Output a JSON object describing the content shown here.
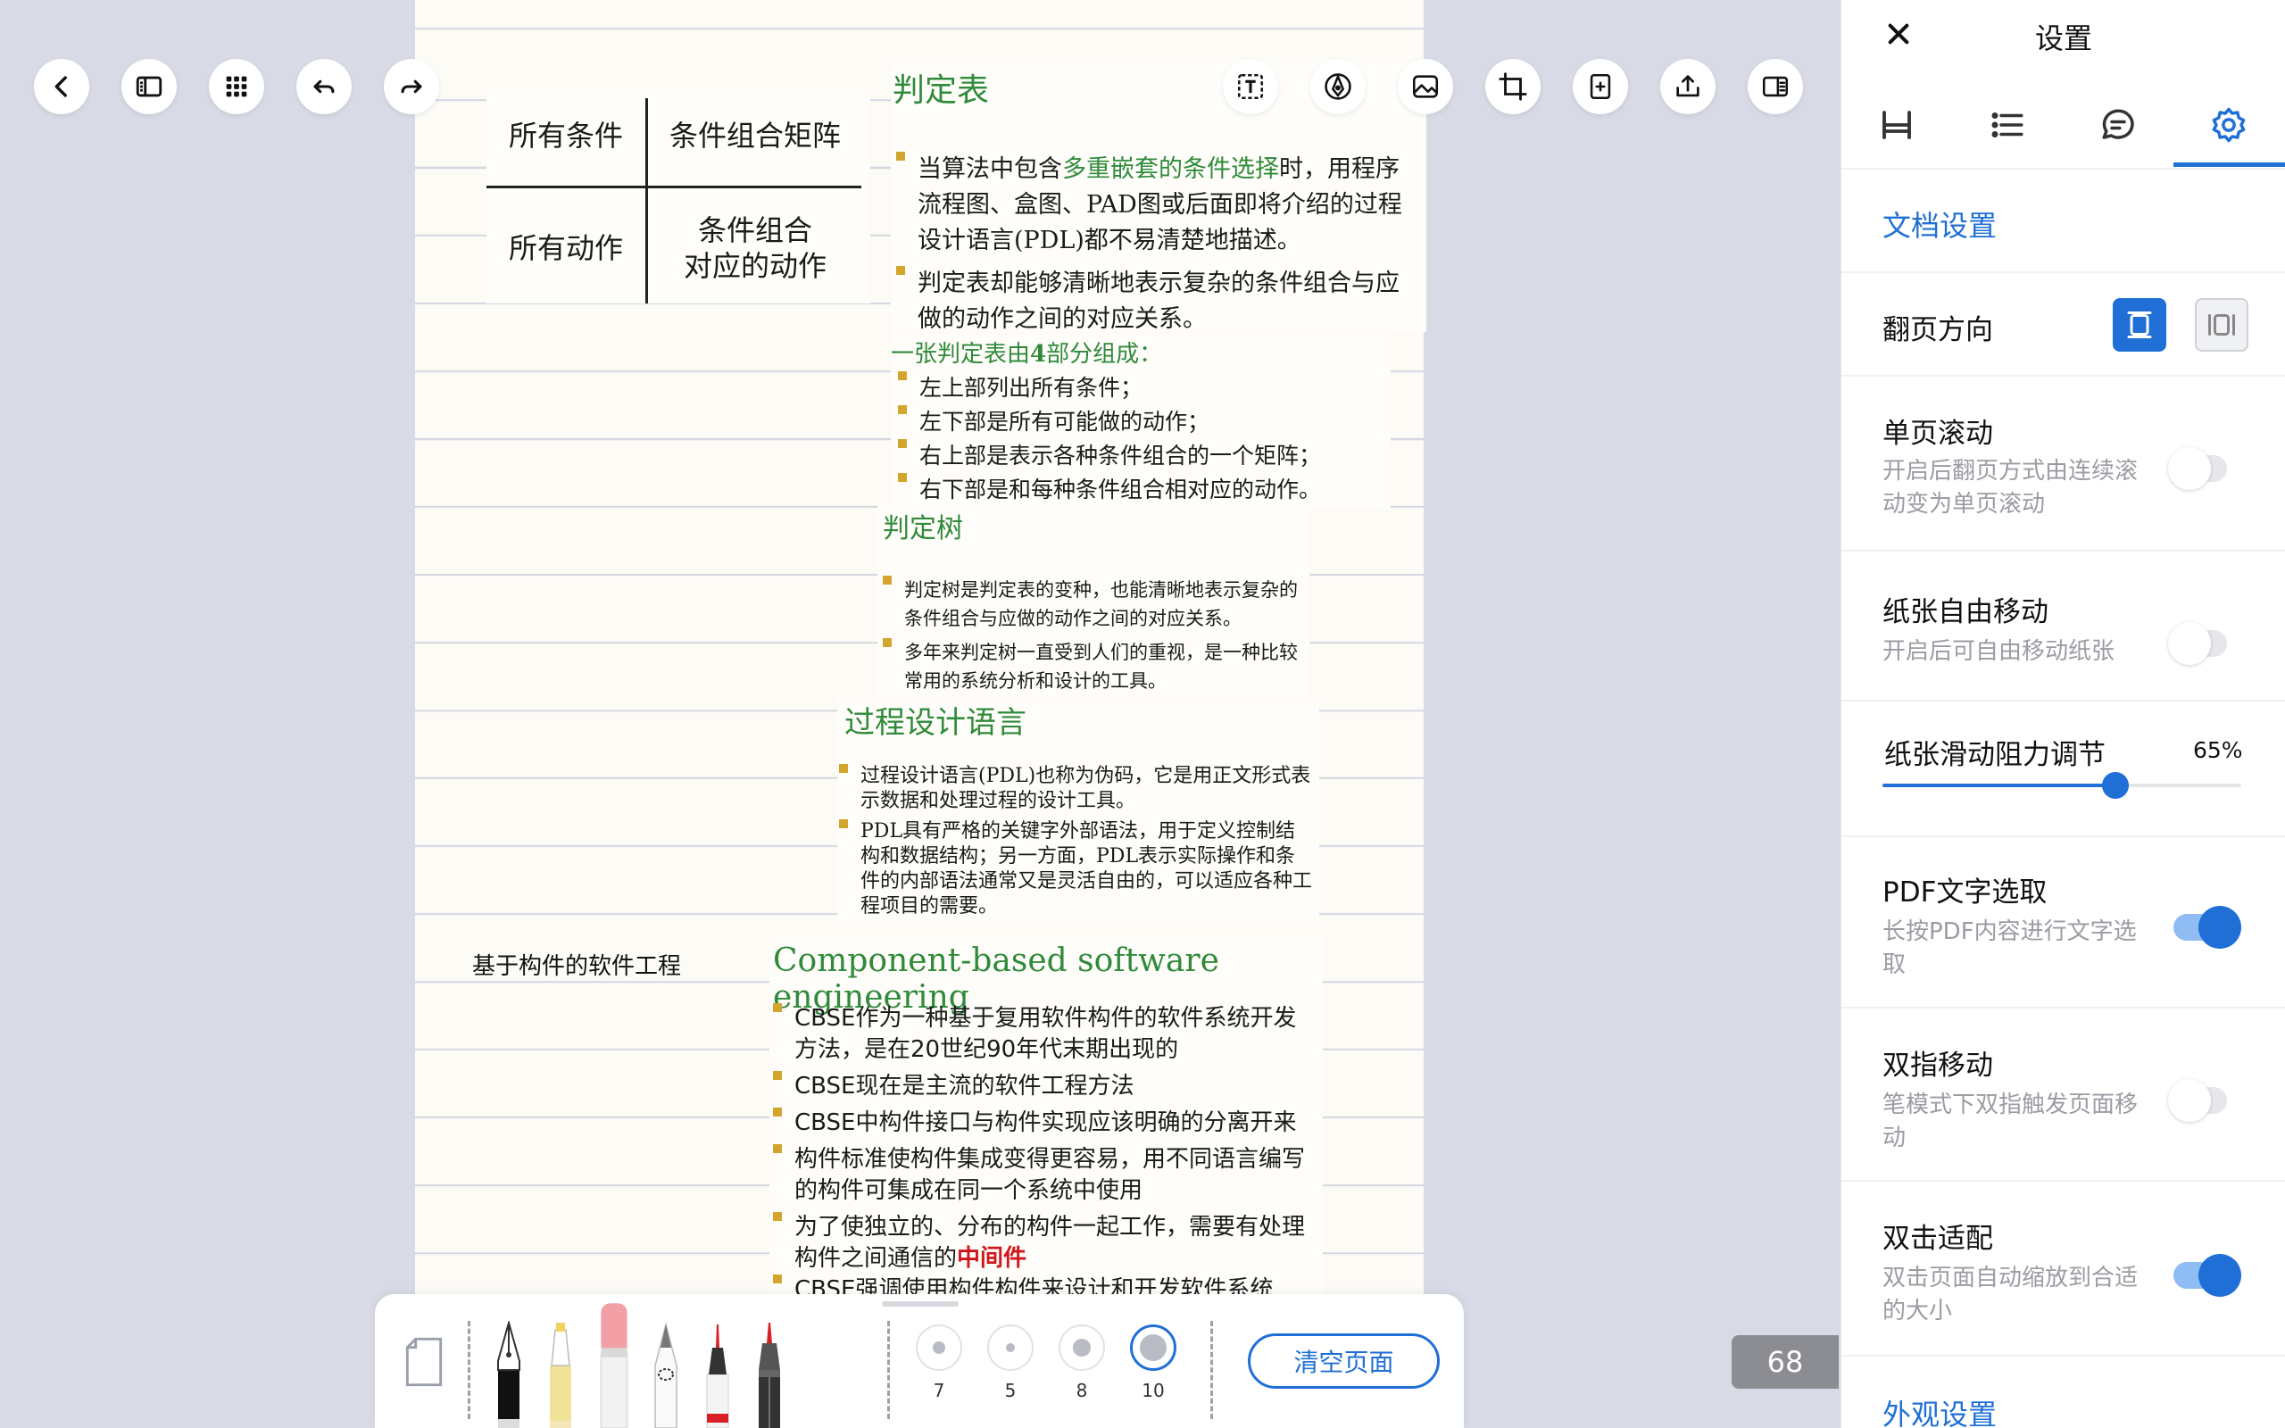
{
  "toolbar_left": {
    "back": "back-icon",
    "sidebar": "sidebar-toggle-icon",
    "grid": "grid-icon",
    "undo": "undo-icon",
    "redo": "redo-icon"
  },
  "toolbar_right": {
    "text_box": "text-box-icon",
    "pen_mode": "pen-mode-icon",
    "image": "image-icon",
    "crop": "crop-icon",
    "add_page": "add-page-icon",
    "share": "share-icon",
    "reader": "reader-view-icon"
  },
  "document": {
    "table": {
      "top_left": "所有条件",
      "top_right": "条件组合矩阵",
      "bottom_left": "所有动作",
      "bottom_right_line1": "条件组合",
      "bottom_right_line2": "对应的动作"
    },
    "decision_table": {
      "heading": "判定表",
      "bullet1_pre": "当算法中包含",
      "bullet1_highlight": "多重嵌套的条件选择",
      "bullet1_post": "时，用程序流程图、盒图、PAD图或后面即将介绍的过程设计语言(PDL)都不易清楚地描述。",
      "bullet2": "判定表却能够清晰地表示复杂的条件组合与应做的动作之间的对应关系。"
    },
    "decision_parts": {
      "intro_pre": "一张判定表由",
      "intro_num": "4",
      "intro_post": "部分组成：",
      "items": [
        "左上部列出所有条件；",
        "左下部是所有可能做的动作；",
        "右上部是表示各种条件组合的一个矩阵；",
        "右下部是和每种条件组合相对应的动作。"
      ]
    },
    "decision_tree": {
      "heading": "判定树",
      "items": [
        "判定树是判定表的变种，也能清晰地表示复杂的条件组合与应做的动作之间的对应关系。",
        "多年来判定树一直受到人们的重视，是一种比较常用的系统分析和设计的工具。"
      ]
    },
    "pdl": {
      "heading": "过程设计语言",
      "items": [
        "过程设计语言(PDL)也称为伪码，它是用正文形式表示数据和处理过程的设计工具。",
        "PDL具有严格的关键字外部语法，用于定义控制结构和数据结构；另一方面，PDL表示实际操作和条件的内部语法通常又是灵活自由的，可以适应各种工程项目的需要。"
      ]
    },
    "handwritten_note": "基于构件的软件工程",
    "cbse": {
      "heading": "Component-based software engineering",
      "items": [
        "CBSE作为一种基于复用软件构件的软件系统开发方法，是在20世纪90年代末期出现的",
        "CBSE现在是主流的软件工程方法",
        "CBSE中构件接口与构件实现应该明确的分离开来",
        "构件标准使构件集成变得更容易，用不同语言编写的构件可集成在同一个系统中使用"
      ],
      "last_pre": "为了使独立的、分布的构件一起工作，需要有处理构件之间通信的",
      "last_highlight": "中间件",
      "cut_line": "CBSE强调使用构件构件来设计和开发软件系统"
    }
  },
  "pen_toolbar": {
    "sizes": [
      "7",
      "5",
      "8",
      "10"
    ],
    "active_size": "10",
    "clear_label": "清空页面"
  },
  "page_number": "68",
  "settings": {
    "close": "close-icon",
    "title": "设置",
    "tabs": [
      "page-layout-icon",
      "list-icon",
      "comment-icon",
      "settings-gear-icon"
    ],
    "document_section": "文档设置",
    "page_direction": "翻页方向",
    "single_scroll": {
      "title": "单页滚动",
      "desc": "开启后翻页方式由连续滚动变为单页滚动",
      "on": false
    },
    "free_move": {
      "title": "纸张自由移动",
      "desc": "开启后可自由移动纸张",
      "on": false
    },
    "resistance": {
      "title": "纸张滑动阻力调节",
      "value_text": "65%",
      "value": 0.65
    },
    "pdf_select": {
      "title": "PDF文字选取",
      "desc": "长按PDF内容进行文字选取",
      "on": true
    },
    "two_finger": {
      "title": "双指移动",
      "desc": "笔模式下双指触发页面移动",
      "on": false
    },
    "double_tap": {
      "title": "双击适配",
      "desc": "双击页面自动缩放到合适的大小",
      "on": true
    },
    "appearance_section": "外观设置"
  },
  "colors": {
    "accent": "#1f6fd6",
    "heading_green": "#2f8a3a",
    "highlight_red": "#d0151b",
    "bullet_gold": "#d4a52c"
  }
}
